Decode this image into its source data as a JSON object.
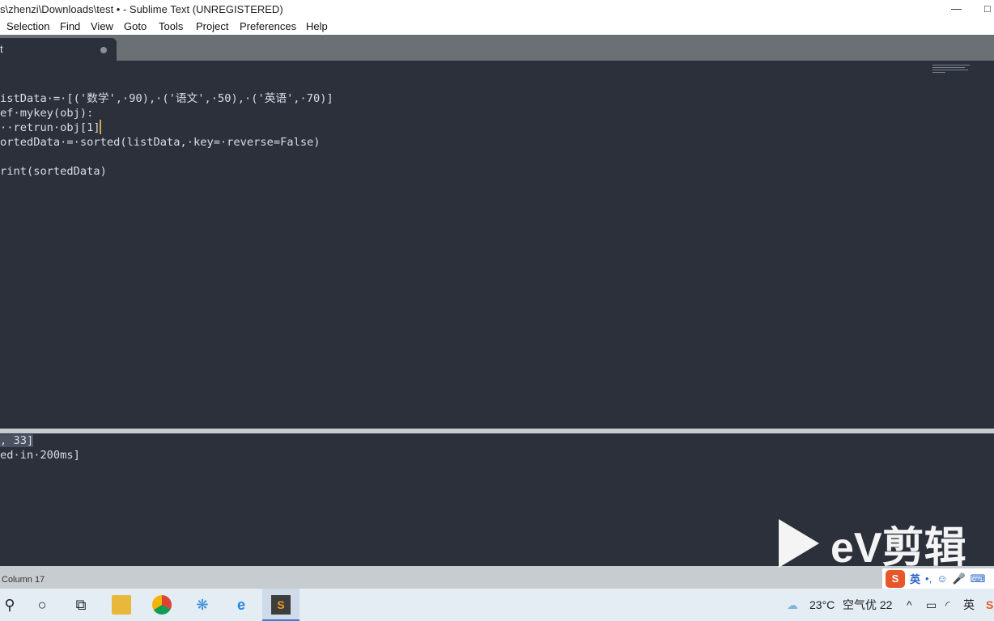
{
  "window": {
    "title": "s\\zhenzi\\Downloads\\test • - Sublime Text (UNREGISTERED)",
    "maximize_icon": "□"
  },
  "menu": [
    "Selection",
    "Find",
    "View",
    "Goto",
    "Tools",
    "Project",
    "Preferences",
    "Help"
  ],
  "tab": {
    "label": "t"
  },
  "editor": {
    "lines": [
      "istData·=·[('数学',·90),·('语文',·50),·('英语',·70)]",
      "ef·mykey(obj):",
      "··retrun·obj[1]",
      "ortedData·=·sorted(listData,·key=·reverse=False)",
      "",
      "rint(sortedData)"
    ]
  },
  "output": {
    "lines": [
      ", 33]",
      "ed·in·200ms]"
    ]
  },
  "status": {
    "position": "Column 17"
  },
  "watermark": {
    "text": "eV剪辑"
  },
  "ime": {
    "logo": "S",
    "lang": "英",
    "punct": "•,",
    "emoji": "☺",
    "mic": "🎤",
    "keyboard": "⌨"
  },
  "taskbar": {
    "weather": "23°C",
    "air": "空气优 22",
    "chevron": "^",
    "lang": "英"
  }
}
